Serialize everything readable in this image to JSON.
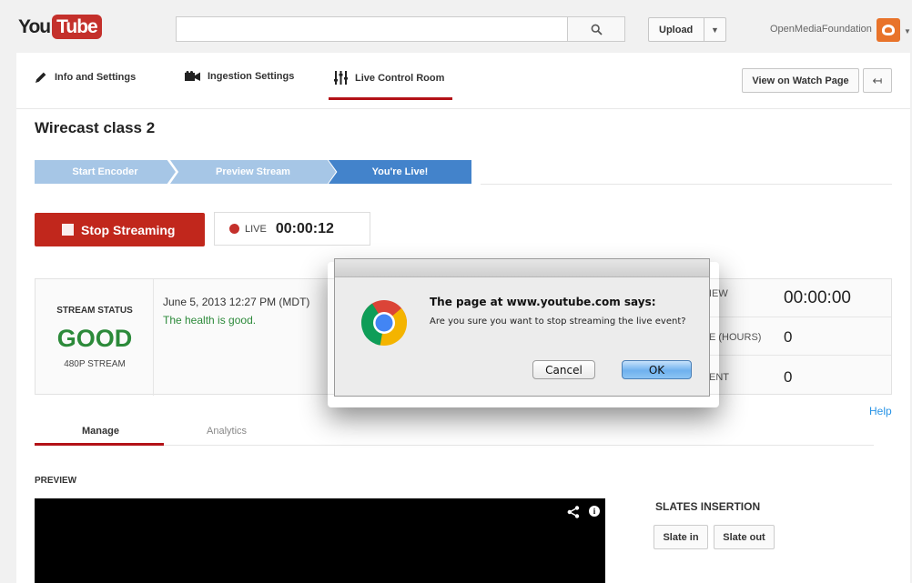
{
  "masthead": {
    "logo_you": "You",
    "logo_tube": "Tube",
    "search_placeholder": "",
    "upload_label": "Upload",
    "username": "OpenMediaFoundation"
  },
  "tabs": [
    {
      "label": "Info and Settings"
    },
    {
      "label": "Ingestion Settings"
    },
    {
      "label": "Live Control Room"
    }
  ],
  "header_buttons": {
    "watch_page": "View on Watch Page",
    "back_icon": "↤"
  },
  "event": {
    "title": "Wirecast class 2"
  },
  "steps": [
    "Start Encoder",
    "Preview Stream",
    "You're Live!"
  ],
  "controls": {
    "stop_label": "Stop Streaming",
    "live_label": "LIVE",
    "live_time": "00:00:12"
  },
  "status": {
    "label": "STREAM STATUS",
    "value": "GOOD",
    "resolution": "480P STREAM",
    "date": "June 5, 2013 12:27 PM (MDT)",
    "health": "The health is good."
  },
  "stats": [
    {
      "label": "IEW",
      "value": "00:00:00"
    },
    {
      "label": "E (HOURS)",
      "value": "0"
    },
    {
      "label": "ENT",
      "value": "0"
    }
  ],
  "help": "Help",
  "subtabs": [
    "Manage",
    "Analytics"
  ],
  "preview_label": "PREVIEW",
  "slates": {
    "title": "SLATES INSERTION",
    "slate_in": "Slate in",
    "slate_out": "Slate out"
  },
  "dialog": {
    "heading": "The page at www.youtube.com says:",
    "message": "Are you sure you want to stop streaming the live event?",
    "cancel": "Cancel",
    "ok": "OK"
  },
  "colors": {
    "brand_red": "#c4302b",
    "accent_blue": "#4383cb",
    "good_green": "#2c8a3a"
  }
}
